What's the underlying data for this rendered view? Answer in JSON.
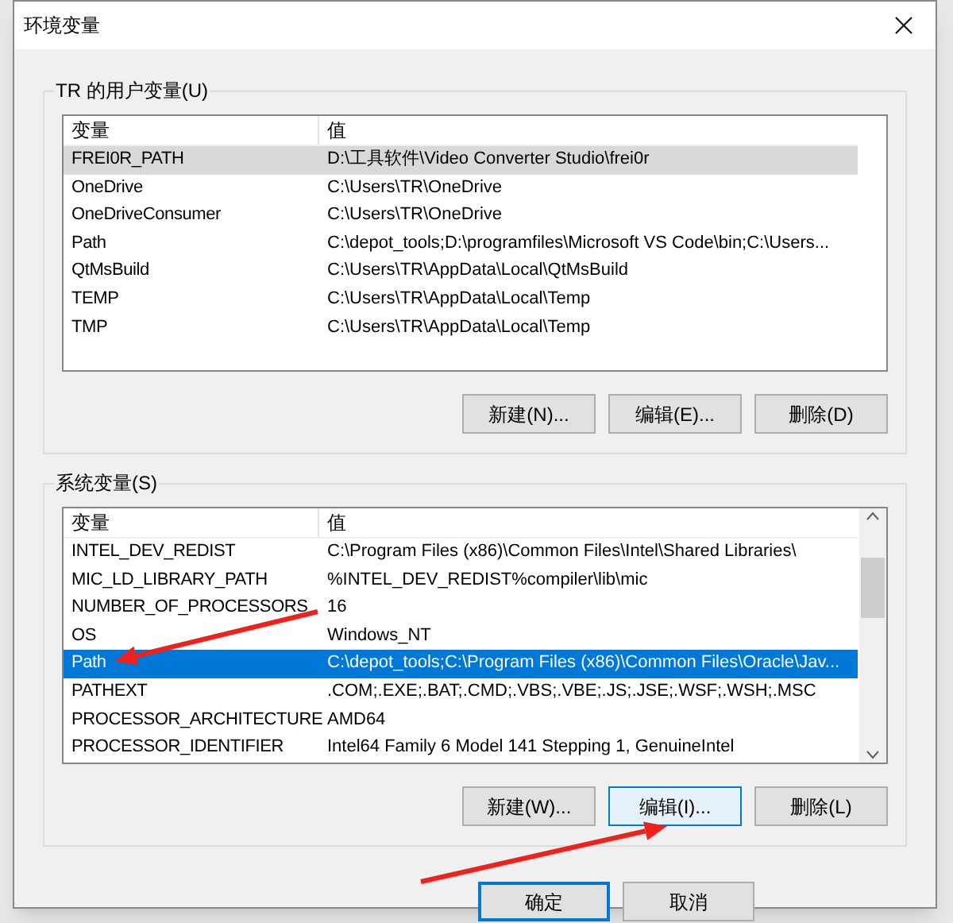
{
  "window": {
    "title": "环境变量"
  },
  "user_vars": {
    "label": "TR 的用户变量(U)",
    "list_focused": false,
    "columns": [
      "变量",
      "值"
    ],
    "rows": [
      {
        "name": "FREI0R_PATH",
        "value": "D:\\工具软件\\Video Converter Studio\\frei0r",
        "selected": true
      },
      {
        "name": "OneDrive",
        "value": "C:\\Users\\TR\\OneDrive",
        "selected": false
      },
      {
        "name": "OneDriveConsumer",
        "value": "C:\\Users\\TR\\OneDrive",
        "selected": false
      },
      {
        "name": "Path",
        "value": "C:\\depot_tools;D:\\programfiles\\Microsoft VS Code\\bin;C:\\Users...",
        "selected": false
      },
      {
        "name": "QtMsBuild",
        "value": "C:\\Users\\TR\\AppData\\Local\\QtMsBuild",
        "selected": false
      },
      {
        "name": "TEMP",
        "value": "C:\\Users\\TR\\AppData\\Local\\Temp",
        "selected": false
      },
      {
        "name": "TMP",
        "value": "C:\\Users\\TR\\AppData\\Local\\Temp",
        "selected": false
      }
    ],
    "buttons": [
      {
        "label": "新建(N)...",
        "focused": false
      },
      {
        "label": "编辑(E)...",
        "focused": false
      },
      {
        "label": "删除(D)",
        "focused": false
      }
    ]
  },
  "system_vars": {
    "label": "系统变量(S)",
    "list_focused": true,
    "columns": [
      "变量",
      "值"
    ],
    "rows": [
      {
        "name": "INTEL_DEV_REDIST",
        "value": "C:\\Program Files (x86)\\Common Files\\Intel\\Shared Libraries\\",
        "selected": false
      },
      {
        "name": "MIC_LD_LIBRARY_PATH",
        "value": "%INTEL_DEV_REDIST%compiler\\lib\\mic",
        "selected": false
      },
      {
        "name": "NUMBER_OF_PROCESSORS",
        "value": "16",
        "selected": false
      },
      {
        "name": "OS",
        "value": "Windows_NT",
        "selected": false
      },
      {
        "name": "Path",
        "value": "C:\\depot_tools;C:\\Program Files (x86)\\Common Files\\Oracle\\Jav...",
        "selected": true
      },
      {
        "name": "PATHEXT",
        "value": ".COM;.EXE;.BAT;.CMD;.VBS;.VBE;.JS;.JSE;.WSF;.WSH;.MSC",
        "selected": false
      },
      {
        "name": "PROCESSOR_ARCHITECTURE",
        "value": "AMD64",
        "selected": false
      },
      {
        "name": "PROCESSOR_IDENTIFIER",
        "value": "Intel64 Family 6 Model 141 Stepping 1, GenuineIntel",
        "selected": false
      }
    ],
    "buttons": [
      {
        "label": "新建(W)...",
        "focused": false
      },
      {
        "label": "编辑(I)...",
        "focused": true
      },
      {
        "label": "删除(L)",
        "focused": false
      }
    ]
  },
  "footer_buttons": [
    {
      "label": "确定",
      "default": true
    },
    {
      "label": "取消",
      "default": false
    }
  ]
}
